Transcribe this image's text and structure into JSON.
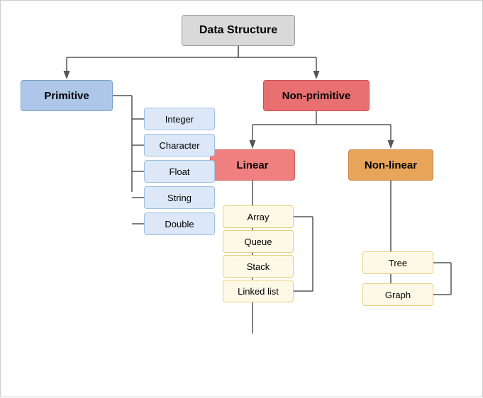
{
  "title": "Data Structure",
  "nodes": {
    "root": "Data Structure",
    "primitive": "Primitive",
    "nonprimitive": "Non-primitive",
    "linear": "Linear",
    "nonlinear": "Non-linear",
    "prim_items": [
      "Integer",
      "Character",
      "Float",
      "String",
      "Double"
    ],
    "linear_items": [
      "Array",
      "Queue",
      "Stack",
      "Linked list"
    ],
    "nonlinear_items": [
      "Tree",
      "Graph"
    ]
  }
}
